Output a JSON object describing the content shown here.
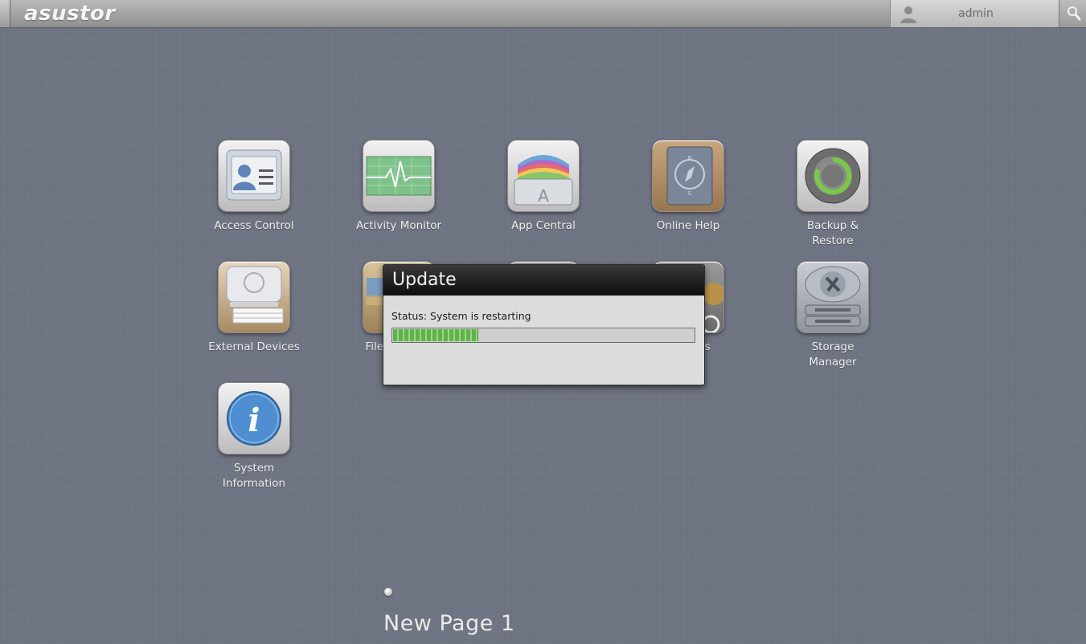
{
  "header": {
    "logo_text": "asustor",
    "user_name": "admin",
    "search_icon": "search-icon",
    "user_icon": "user-silhouette-icon"
  },
  "apps": [
    {
      "label": "Access Control",
      "icon": "access-control-icon"
    },
    {
      "label": "Activity Monitor",
      "icon": "activity-monitor-icon"
    },
    {
      "label": "App Central",
      "icon": "app-central-icon"
    },
    {
      "label": "Online Help",
      "icon": "online-help-icon"
    },
    {
      "label": "Backup &\nRestore",
      "icon": "backup-restore-icon"
    },
    {
      "label": "External Devices",
      "icon": "external-devices-icon"
    },
    {
      "label": "File Explorer",
      "icon": "file-explorer-icon"
    },
    {
      "label": "",
      "icon": "hidden-app-icon"
    },
    {
      "label": "Settings",
      "icon": "settings-icon"
    },
    {
      "label": "Storage\nManager",
      "icon": "storage-manager-icon"
    },
    {
      "label": "System\nInformation",
      "icon": "system-information-icon"
    }
  ],
  "dialog": {
    "title": "Update",
    "status": "Status: System is restarting",
    "progress": 0.28
  },
  "page": {
    "title": "New Page 1"
  },
  "colors": {
    "desktop_bg": "#6f7483",
    "progress_green": "#5fb34a",
    "dialog_header": "#0d0d0d"
  }
}
